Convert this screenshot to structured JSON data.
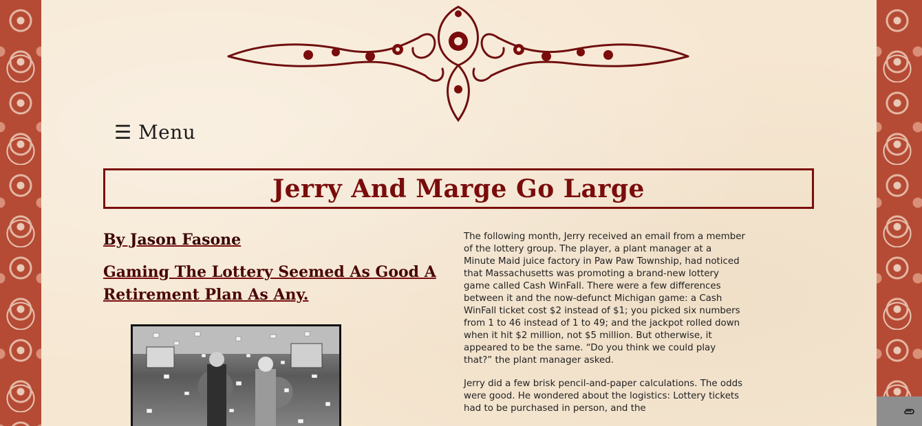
{
  "page": {
    "menu_label": "☰ Menu",
    "title": "Jerry And Marge Go Large"
  },
  "article": {
    "byline": "By Jason Fasone",
    "subhead": "Gaming The Lottery Seemed As Good A Retirement Plan As Any.",
    "paragraphs": [
      "The following month, Jerry received an email from a member of the lottery group. The player, a plant manager at a Minute Maid juice factory in Paw Paw Township, had noticed that Massachusetts was promoting a brand-new lottery game called Cash WinFall. There were a few differences between it and the now-defunct Michigan game: a Cash WinFall ticket cost $2 instead of $1; you picked six numbers from 1 to 46 instead of 1 to 49; and the jackpot rolled down when it hit $2 million, not $5 million. But otherwise, it appeared to be the same. “Do you think we could play that?” the plant manager asked.",
      "Jerry did a few brisk pencil-and-paper calculations. The odds were good. He wondered about the logistics: Lottery tickets had to be purchased in person, and the"
    ]
  },
  "icons": {
    "attach": "paperclip-icon",
    "ornament": "ornament-flourish",
    "photo": "lottery-photo"
  },
  "colors": {
    "accent": "#7a0c0c",
    "parchment": "#f6e7d2",
    "border_pattern": "#b54a35"
  }
}
